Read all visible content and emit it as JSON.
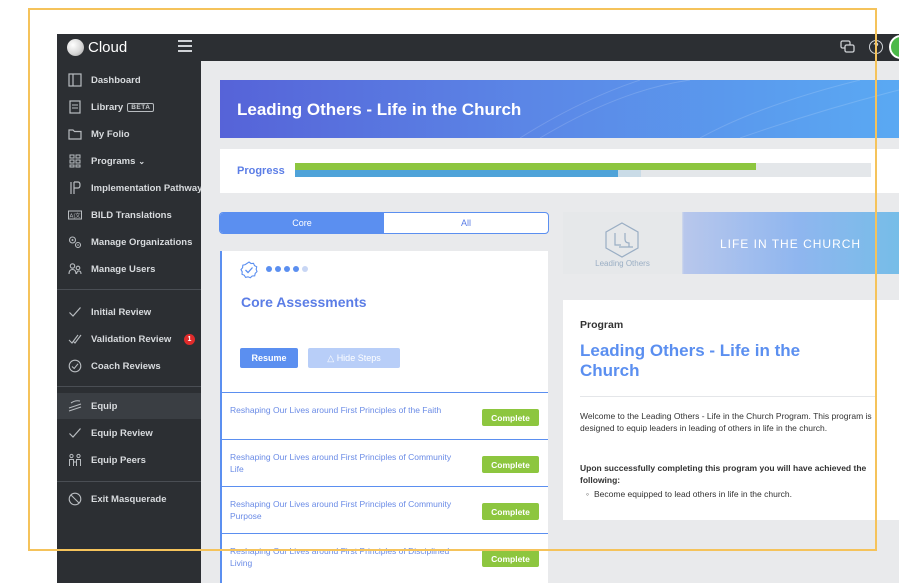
{
  "app": {
    "brand": "Cloud"
  },
  "sidebar": {
    "items": [
      {
        "label": "Dashboard",
        "icon": "dashboard-icon"
      },
      {
        "label": "Library",
        "badge": "BETA",
        "icon": "library-icon"
      },
      {
        "label": "My Folio",
        "icon": "folder-icon"
      },
      {
        "label": "Programs",
        "icon": "programs-icon"
      },
      {
        "label": "Implementation Pathway",
        "icon": "pathway-icon"
      },
      {
        "label": "BILD Translations",
        "icon": "translate-icon"
      },
      {
        "label": "Manage Organizations",
        "icon": "organizations-icon"
      },
      {
        "label": "Manage Users",
        "icon": "users-icon"
      },
      {
        "label": "Initial Review",
        "icon": "check-icon"
      },
      {
        "label": "Validation Review",
        "count": "1",
        "icon": "double-check-icon"
      },
      {
        "label": "Coach Reviews",
        "icon": "coach-check-icon"
      },
      {
        "label": "Equip",
        "icon": "equip-icon"
      },
      {
        "label": "Equip Review",
        "icon": "check-icon"
      },
      {
        "label": "Equip Peers",
        "icon": "peers-icon"
      },
      {
        "label": "Exit Masquerade",
        "icon": "exit-icon"
      }
    ]
  },
  "header": {
    "title": "Leading Others - Life in the Church"
  },
  "progress": {
    "label": "Progress",
    "primary_fraction": 0.8,
    "secondary_fraction": 0.56,
    "secondary_light_fraction": 0.6
  },
  "tabs": [
    {
      "label": "Core",
      "active": true
    },
    {
      "label": "All",
      "active": false
    }
  ],
  "assessment": {
    "title": "Core Assessments",
    "resume_label": "Resume",
    "hide_steps_label": "△ Hide Steps",
    "steps": [
      {
        "title": "Reshaping Our Lives around First Principles of the Faith",
        "status": "Complete"
      },
      {
        "title": "Reshaping Our Lives around First Principles of Community Life",
        "status": "Complete"
      },
      {
        "title": "Reshaping Our Lives around First Principles of Community Purpose",
        "status": "Complete"
      },
      {
        "title": "Reshaping Our Lives around First Principles of Disciplined Living",
        "status": "Complete"
      }
    ]
  },
  "banner": {
    "subtitle": "Leading Others",
    "title": "LIFE IN THE CHURCH"
  },
  "program": {
    "label": "Program",
    "title": "Leading Others - Life in the Church",
    "description": "Welcome to the Leading Others - Life in the Church Program. This program is designed to equip leaders in leading of others in life in the church.",
    "upon_text": "Upon successfully completing this program you will have achieved the following:",
    "outcomes": [
      "Become equipped to lead others in life in the church."
    ]
  },
  "colors": {
    "accent": "#5b8ff0",
    "success": "#8dc63f",
    "sidebar": "#2c2f33",
    "highlight": "#f5c35b"
  }
}
